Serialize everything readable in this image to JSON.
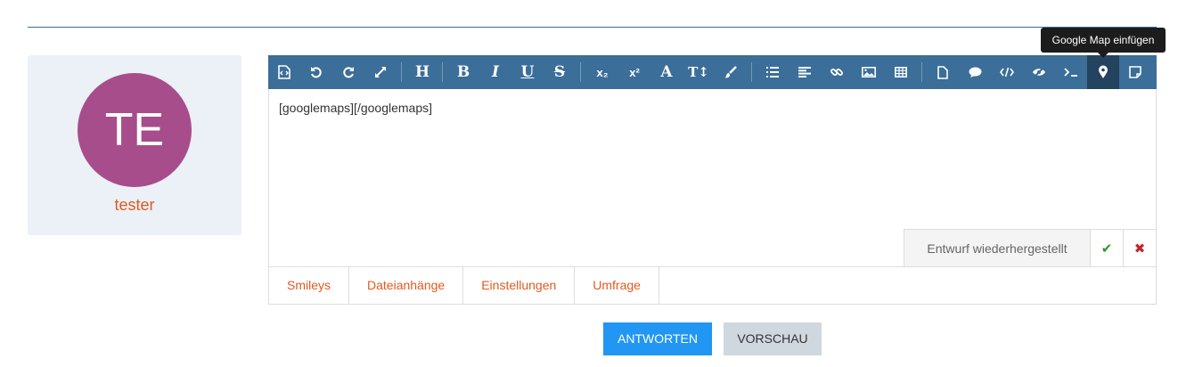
{
  "author": {
    "initials": "TE",
    "name": "tester"
  },
  "editor": {
    "content": "[googlemaps][/googlemaps]",
    "draft_message": "Entwurf wiederhergestellt",
    "accept_icon": "check-icon",
    "discard_icon": "close-icon"
  },
  "toolbar": {
    "buttons": [
      "source-code",
      "undo",
      "redo",
      "fullscreen",
      "heading",
      "bold",
      "italic",
      "underline",
      "strikethrough",
      "subscript",
      "superscript",
      "font-color",
      "font-size",
      "paint-brush",
      "bullet-list",
      "align-left",
      "link",
      "image",
      "table",
      "page",
      "quote",
      "code",
      "spoiler",
      "terminal",
      "google-map",
      "sticky-note"
    ],
    "labels": {
      "heading": "H",
      "bold": "B",
      "italic": "I",
      "underline": "U",
      "strike": "S",
      "sub": "x₂",
      "sup": "x²",
      "color": "A",
      "size": "T↕"
    },
    "active_button": "google-map",
    "tooltip": "Google Map einfügen"
  },
  "tabs": [
    "Smileys",
    "Dateianhänge",
    "Einstellungen",
    "Umfrage"
  ],
  "actions": {
    "reply": "ANTWORTEN",
    "preview": "VORSCHAU"
  },
  "colors": {
    "toolbar": "#3b6e99",
    "active_button": "#23435f",
    "accent_orange": "#e05a20",
    "primary_button": "#2196f3",
    "avatar": "#a84d8b"
  }
}
